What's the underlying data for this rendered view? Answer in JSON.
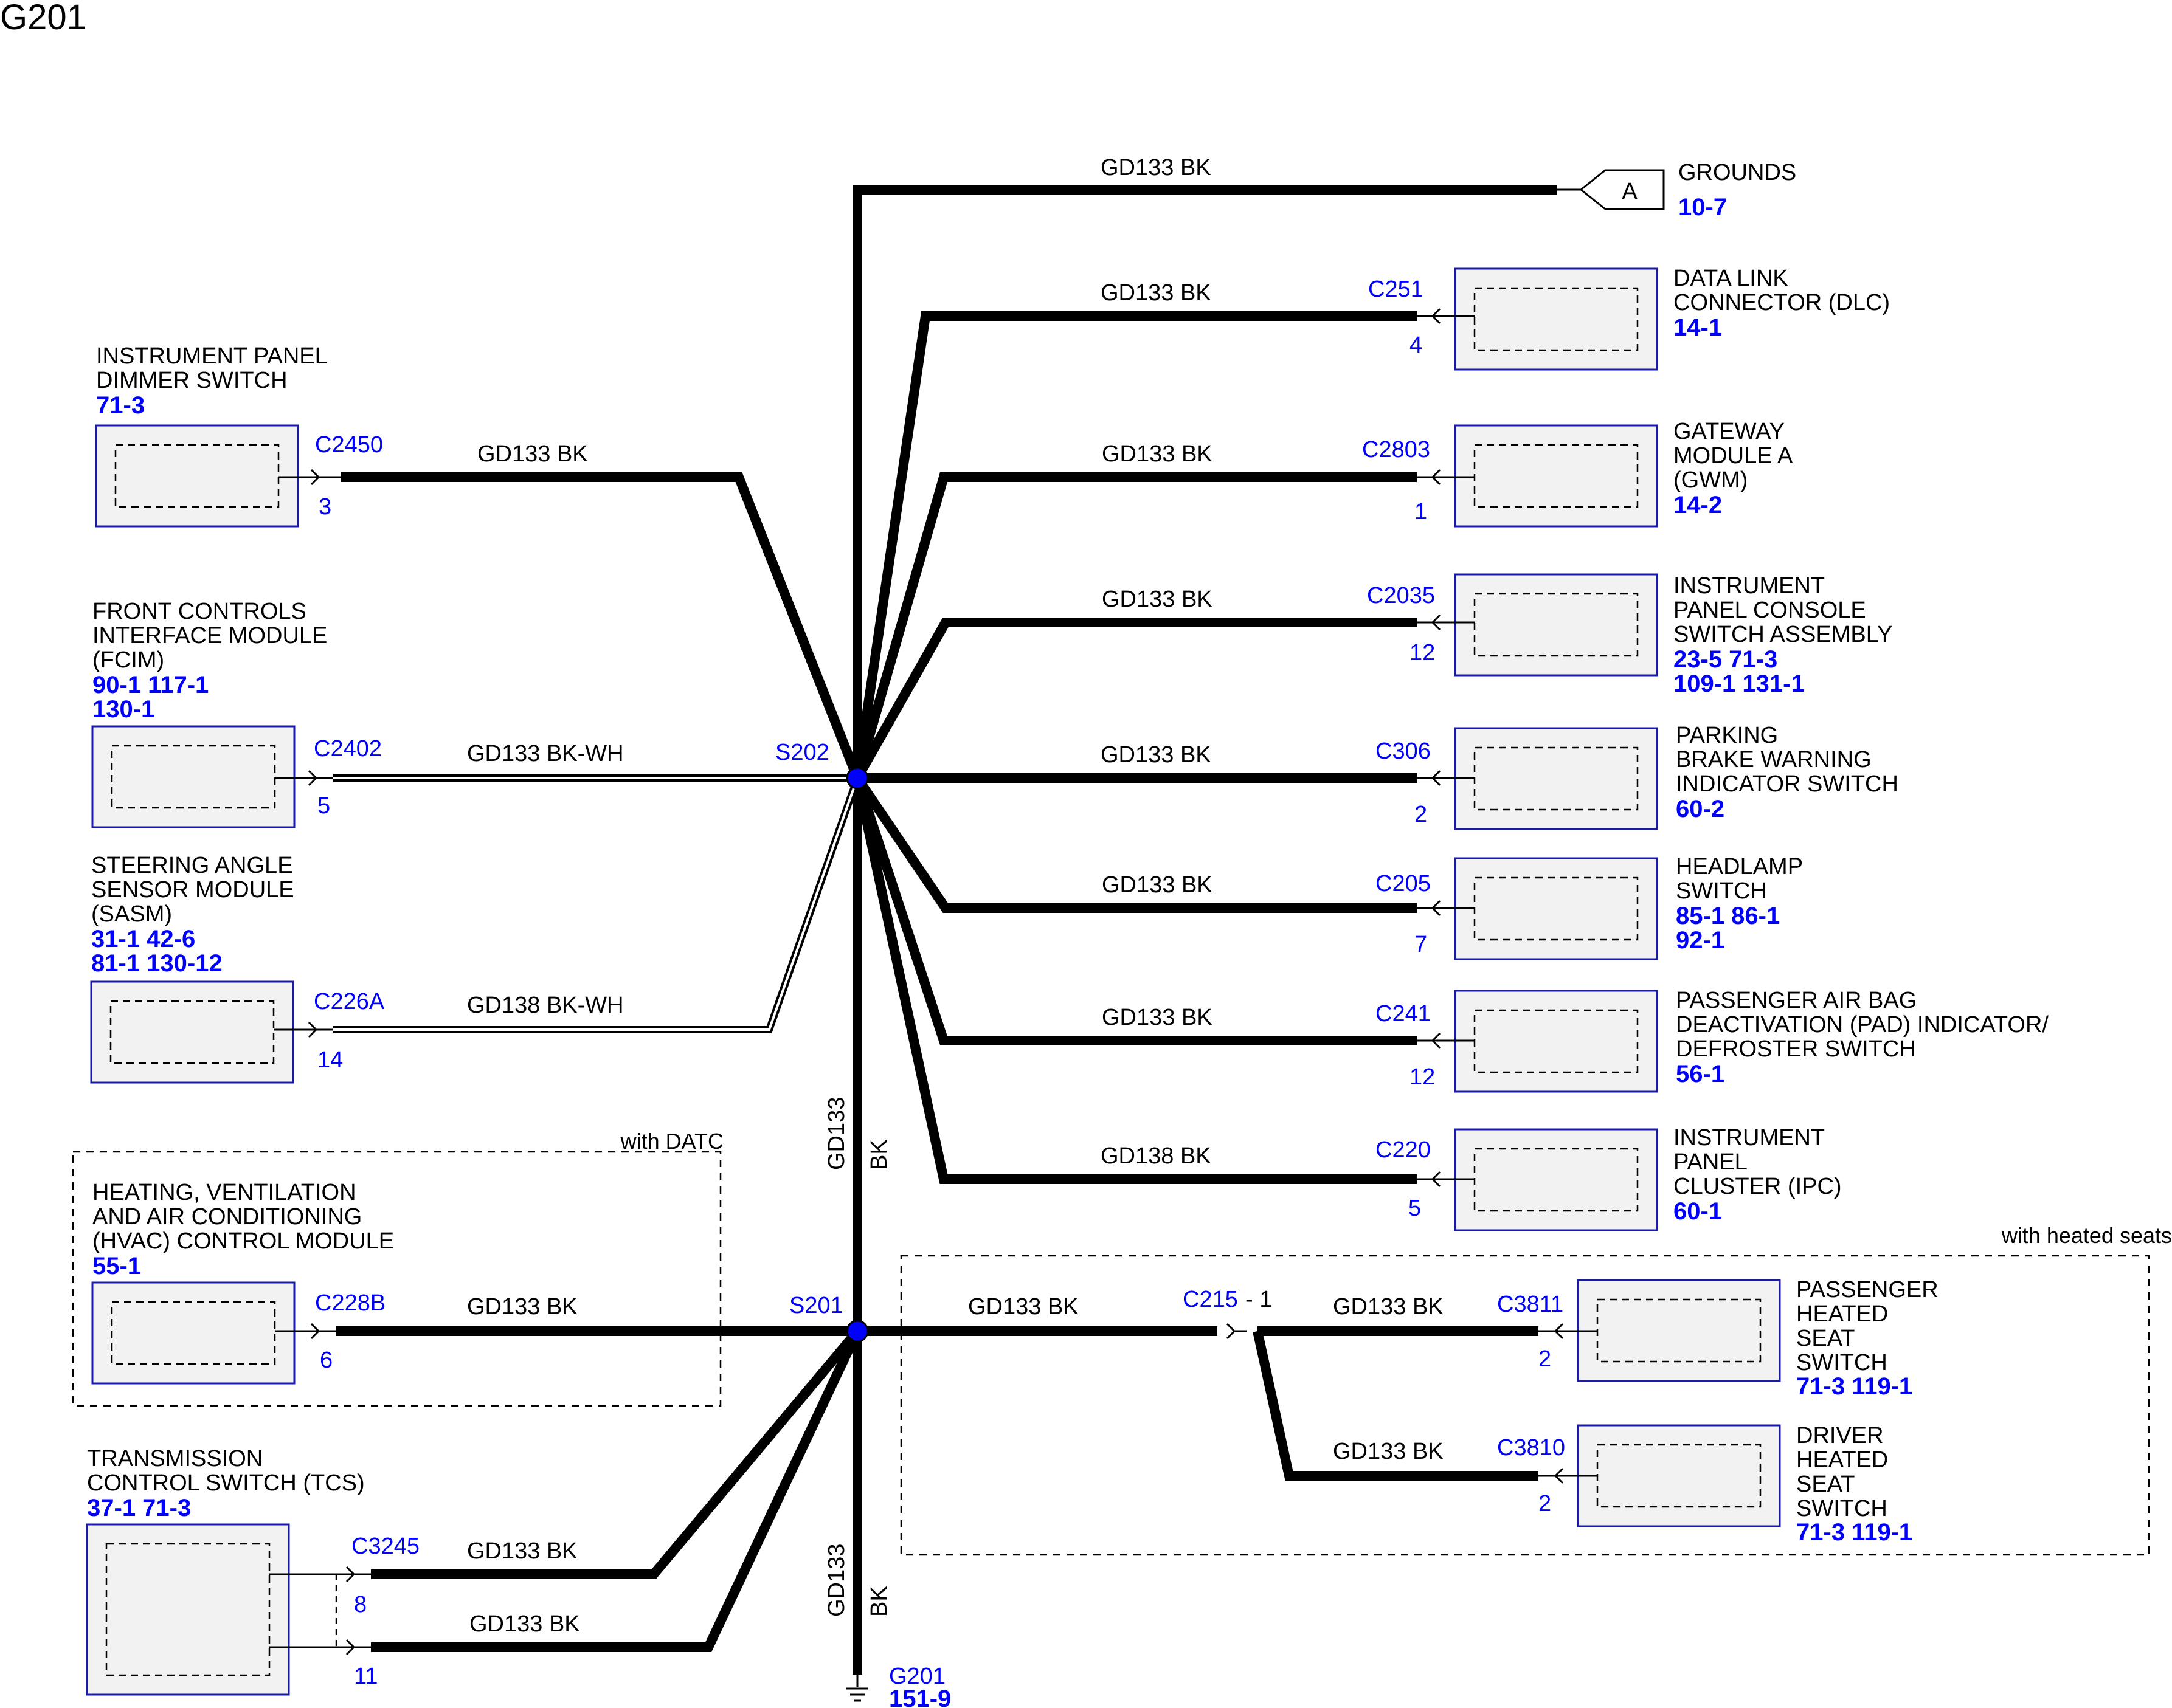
{
  "title": "G201",
  "wire_labels": {
    "gd133_bk": "GD133  BK",
    "gd133_bkwh": "GD133  BK-WH",
    "gd138_bkwh": "GD138  BK-WH",
    "gd138_bk": "GD138  BK",
    "vertical_gd133": "GD133",
    "vertical_bk": "BK"
  },
  "splices": {
    "s202": "S202",
    "s201": "S201"
  },
  "inline_connector": {
    "id": "C215",
    "pin": "- 1"
  },
  "optional_groups": {
    "datc": "with DATC",
    "heated_seats": "with heated seats"
  },
  "ground": {
    "id": "G201",
    "ref": "151-9"
  },
  "grounds_ref": {
    "letter": "A",
    "lines": [
      "GROUNDS"
    ],
    "ref1": "10-7",
    "ref2": ""
  },
  "components": [
    {
      "key": "dlc",
      "connector": "C251",
      "pin": "4",
      "lines": [
        "DATA LINK",
        "CONNECTOR (DLC)"
      ],
      "ref1": "14-1",
      "ref2": ""
    },
    {
      "key": "gwm",
      "connector": "C2803",
      "pin": "1",
      "lines": [
        "GATEWAY",
        "MODULE A",
        "(GWM)"
      ],
      "ref1": "14-2",
      "ref2": ""
    },
    {
      "key": "console",
      "connector": "C2035",
      "pin": "12",
      "lines": [
        "INSTRUMENT",
        "PANEL CONSOLE",
        "SWITCH ASSEMBLY"
      ],
      "ref1": "23-5   71-3",
      "ref2": "109-1 131-1"
    },
    {
      "key": "parking",
      "connector": "C306",
      "pin": "2",
      "lines": [
        "PARKING",
        "BRAKE WARNING",
        "INDICATOR SWITCH"
      ],
      "ref1": "60-2",
      "ref2": ""
    },
    {
      "key": "headlamp",
      "connector": "C205",
      "pin": "7",
      "lines": [
        "HEADLAMP",
        "SWITCH"
      ],
      "ref1": "85-1   86-1",
      "ref2": "92-1"
    },
    {
      "key": "pad",
      "connector": "C241",
      "pin": "12",
      "lines": [
        "PASSENGER AIR BAG",
        "DEACTIVATION (PAD) INDICATOR/",
        "DEFROSTER SWITCH"
      ],
      "ref1": "56-1",
      "ref2": ""
    },
    {
      "key": "ipc",
      "connector": "C220",
      "pin": "5",
      "lines": [
        "INSTRUMENT",
        "PANEL",
        "CLUSTER (IPC)"
      ],
      "ref1": "60-1",
      "ref2": ""
    },
    {
      "key": "pass_seat",
      "connector": "C3811",
      "pin": "2",
      "lines": [
        "PASSENGER",
        "HEATED",
        "SEAT",
        "SWITCH"
      ],
      "ref1": "71-3   119-1",
      "ref2": ""
    },
    {
      "key": "drv_seat",
      "connector": "C3810",
      "pin": "2",
      "lines": [
        "DRIVER",
        "HEATED",
        "SEAT",
        "SWITCH"
      ],
      "ref1": "71-3   119-1",
      "ref2": ""
    },
    {
      "key": "dimmer",
      "connector": "C2450",
      "pin": "3",
      "lines": [
        "INSTRUMENT PANEL",
        "DIMMER SWITCH"
      ],
      "ref1": "71-3",
      "ref2": ""
    },
    {
      "key": "fcim",
      "connector": "C2402",
      "pin": "5",
      "lines": [
        "FRONT CONTROLS",
        "INTERFACE MODULE",
        "(FCIM)"
      ],
      "ref1": "90-1   117-1",
      "ref2": "130-1"
    },
    {
      "key": "sasm",
      "connector": "C226A",
      "pin": "14",
      "lines": [
        "STEERING ANGLE",
        "SENSOR MODULE",
        "(SASM)"
      ],
      "ref1": "31-1   42-6",
      "ref2": "81-1   130-12"
    },
    {
      "key": "hvac",
      "connector": "C228B",
      "pin": "6",
      "lines": [
        "HEATING, VENTILATION",
        "AND AIR CONDITIONING",
        "(HVAC) CONTROL MODULE"
      ],
      "ref1": "55-1",
      "ref2": ""
    },
    {
      "key": "tcs",
      "connector": "C3245",
      "pin": "8",
      "pin2": "11",
      "lines": [
        "TRANSMISSION",
        "CONTROL SWITCH (TCS)"
      ],
      "ref1": "37-1   71-3",
      "ref2": ""
    }
  ]
}
